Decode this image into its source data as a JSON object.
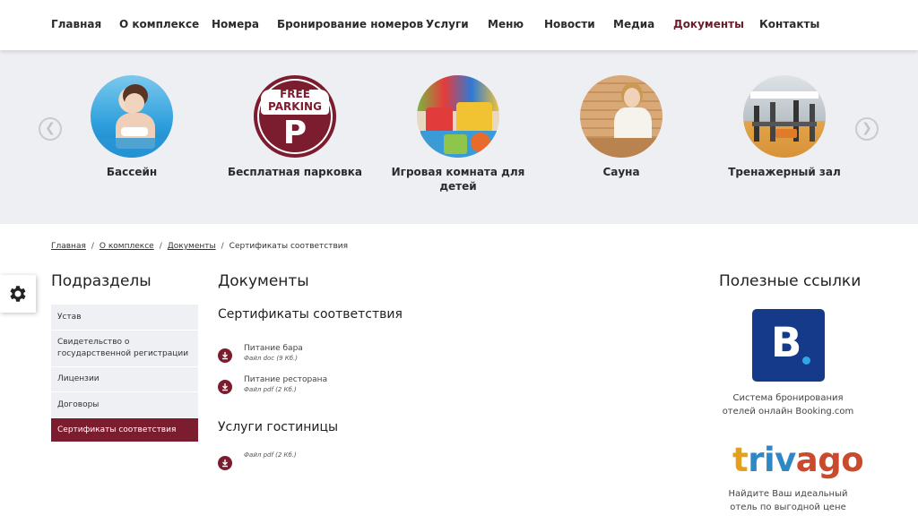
{
  "nav": {
    "items": [
      "Главная",
      "О комплексе",
      "Номера",
      "Бронирование номеров",
      "Услуги",
      "Меню",
      "Новости",
      "Медиа",
      "Документы",
      "Контакты"
    ],
    "active": "Документы"
  },
  "services": [
    {
      "label": "Бассейн",
      "icon": "pool-photo"
    },
    {
      "label": "Бесплатная парковка",
      "icon": "free-parking-photo",
      "badge_line1": "FREE",
      "badge_line2": "PARKING",
      "badge_letter": "P"
    },
    {
      "label": "Игровая комната для детей",
      "icon": "playroom-photo"
    },
    {
      "label": "Сауна",
      "icon": "sauna-photo"
    },
    {
      "label": "Тренажерный зал",
      "icon": "gym-photo"
    }
  ],
  "carousel": {
    "prev_icon": "chevron-left-icon",
    "next_icon": "chevron-right-icon"
  },
  "breadcrumb": {
    "items": [
      "Главная",
      "О комплексе",
      "Документы"
    ],
    "current": "Сертификаты соответствия",
    "separator": "/"
  },
  "sidebar": {
    "title": "Подразделы",
    "items": [
      "Устав",
      "Свидетельство о государственной регистрации",
      "Лицензии",
      "Договоры",
      "Сертификаты соответствия"
    ],
    "active_index": 4
  },
  "main": {
    "title": "Документы",
    "sections": [
      {
        "title": "Сертификаты соответствия",
        "docs": [
          {
            "name": "Питание бара",
            "meta": "Файл doc (9 Кб.)"
          },
          {
            "name": "Питание ресторана",
            "meta": "Файл pdf (2 Кб.)"
          }
        ]
      },
      {
        "title": "Услуги гостиницы",
        "docs": [
          {
            "name": "",
            "meta": "Файл pdf (2 Кб.)"
          }
        ]
      }
    ]
  },
  "useful_links": {
    "title": "Полезные ссылки",
    "booking": {
      "logo_letter": "B",
      "caption_line1": "Система бронирования",
      "caption_line2": "отелей онлайн Booking.com"
    },
    "trivago": {
      "letters": [
        "t",
        "r",
        "i",
        "v",
        "a",
        "g",
        "o"
      ],
      "caption_line1": "Найдите Ваш идеальный",
      "caption_line2": "отель по выгодной цене"
    }
  },
  "colors": {
    "accent": "#7b1d2e",
    "band_bg": "#eeeff3",
    "booking_blue": "#163a8a",
    "trivago_t": "#e3a01f",
    "trivago_r": "#2e88c6",
    "trivago_i": "#2e88c6",
    "trivago_v": "#2e88c6",
    "trivago_a": "#c94a2c",
    "trivago_g": "#c94a2c",
    "trivago_o": "#c94a2c"
  }
}
